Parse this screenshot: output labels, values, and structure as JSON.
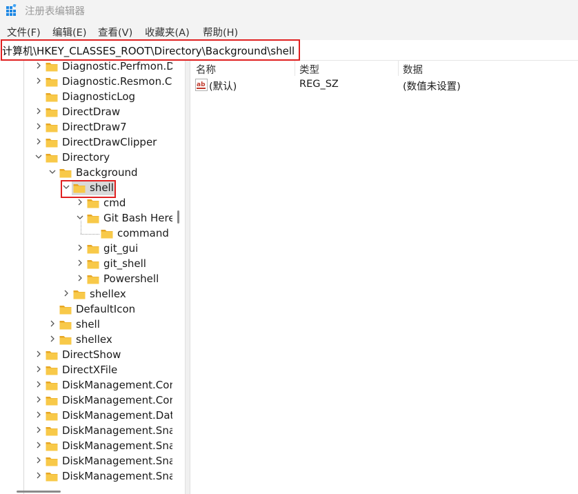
{
  "window": {
    "title": "注册表编辑器"
  },
  "menu": [
    {
      "label": "文件(F)"
    },
    {
      "label": "编辑(E)"
    },
    {
      "label": "查看(V)"
    },
    {
      "label": "收藏夹(A)"
    },
    {
      "label": "帮助(H)"
    }
  ],
  "address": {
    "path": "计算机\\HKEY_CLASSES_ROOT\\Directory\\Background\\shell"
  },
  "tree": {
    "nodes": [
      {
        "label": "Diagnostic.Perfmon.D",
        "expander": "collapsed"
      },
      {
        "label": "Diagnostic.Resmon.Co",
        "expander": "collapsed"
      },
      {
        "label": "DiagnosticLog",
        "expander": "none"
      },
      {
        "label": "DirectDraw",
        "expander": "collapsed"
      },
      {
        "label": "DirectDraw7",
        "expander": "collapsed"
      },
      {
        "label": "DirectDrawClipper",
        "expander": "collapsed"
      },
      {
        "label": "Directory",
        "expander": "expanded"
      },
      {
        "label": "Background",
        "expander": "expanded"
      },
      {
        "label": "shell",
        "expander": "expanded",
        "selected": true
      },
      {
        "label": "cmd",
        "expander": "collapsed"
      },
      {
        "label": "Git Bash Here",
        "expander": "expanded"
      },
      {
        "label": "command",
        "expander": "none"
      },
      {
        "label": "git_gui",
        "expander": "collapsed"
      },
      {
        "label": "git_shell",
        "expander": "collapsed"
      },
      {
        "label": "Powershell",
        "expander": "collapsed"
      },
      {
        "label": "shellex",
        "expander": "collapsed"
      },
      {
        "label": "DefaultIcon",
        "expander": "none"
      },
      {
        "label": "shell",
        "expander": "collapsed"
      },
      {
        "label": "shellex",
        "expander": "collapsed"
      },
      {
        "label": "DirectShow",
        "expander": "collapsed"
      },
      {
        "label": "DirectXFile",
        "expander": "collapsed"
      },
      {
        "label": "DiskManagement.Con",
        "expander": "collapsed"
      },
      {
        "label": "DiskManagement.Con",
        "expander": "collapsed"
      },
      {
        "label": "DiskManagement.Dat",
        "expander": "collapsed"
      },
      {
        "label": "DiskManagement.Sna",
        "expander": "collapsed"
      },
      {
        "label": "DiskManagement.Sna",
        "expander": "collapsed"
      },
      {
        "label": "DiskManagement.Sna",
        "expander": "collapsed"
      },
      {
        "label": "DiskManagement.Sna",
        "expander": "collapsed"
      }
    ]
  },
  "list": {
    "columns": [
      {
        "label": "名称"
      },
      {
        "label": "类型"
      },
      {
        "label": "数据"
      }
    ],
    "rows": [
      {
        "name": "(默认)",
        "type": "REG_SZ",
        "data": "(数值未设置)",
        "icon": "string-value-icon"
      }
    ]
  },
  "colors": {
    "accent_red": "#e02020",
    "folder_yellow": "#f8c949",
    "folder_dark": "#e7a624",
    "selection_gray": "#d9d9d9"
  }
}
